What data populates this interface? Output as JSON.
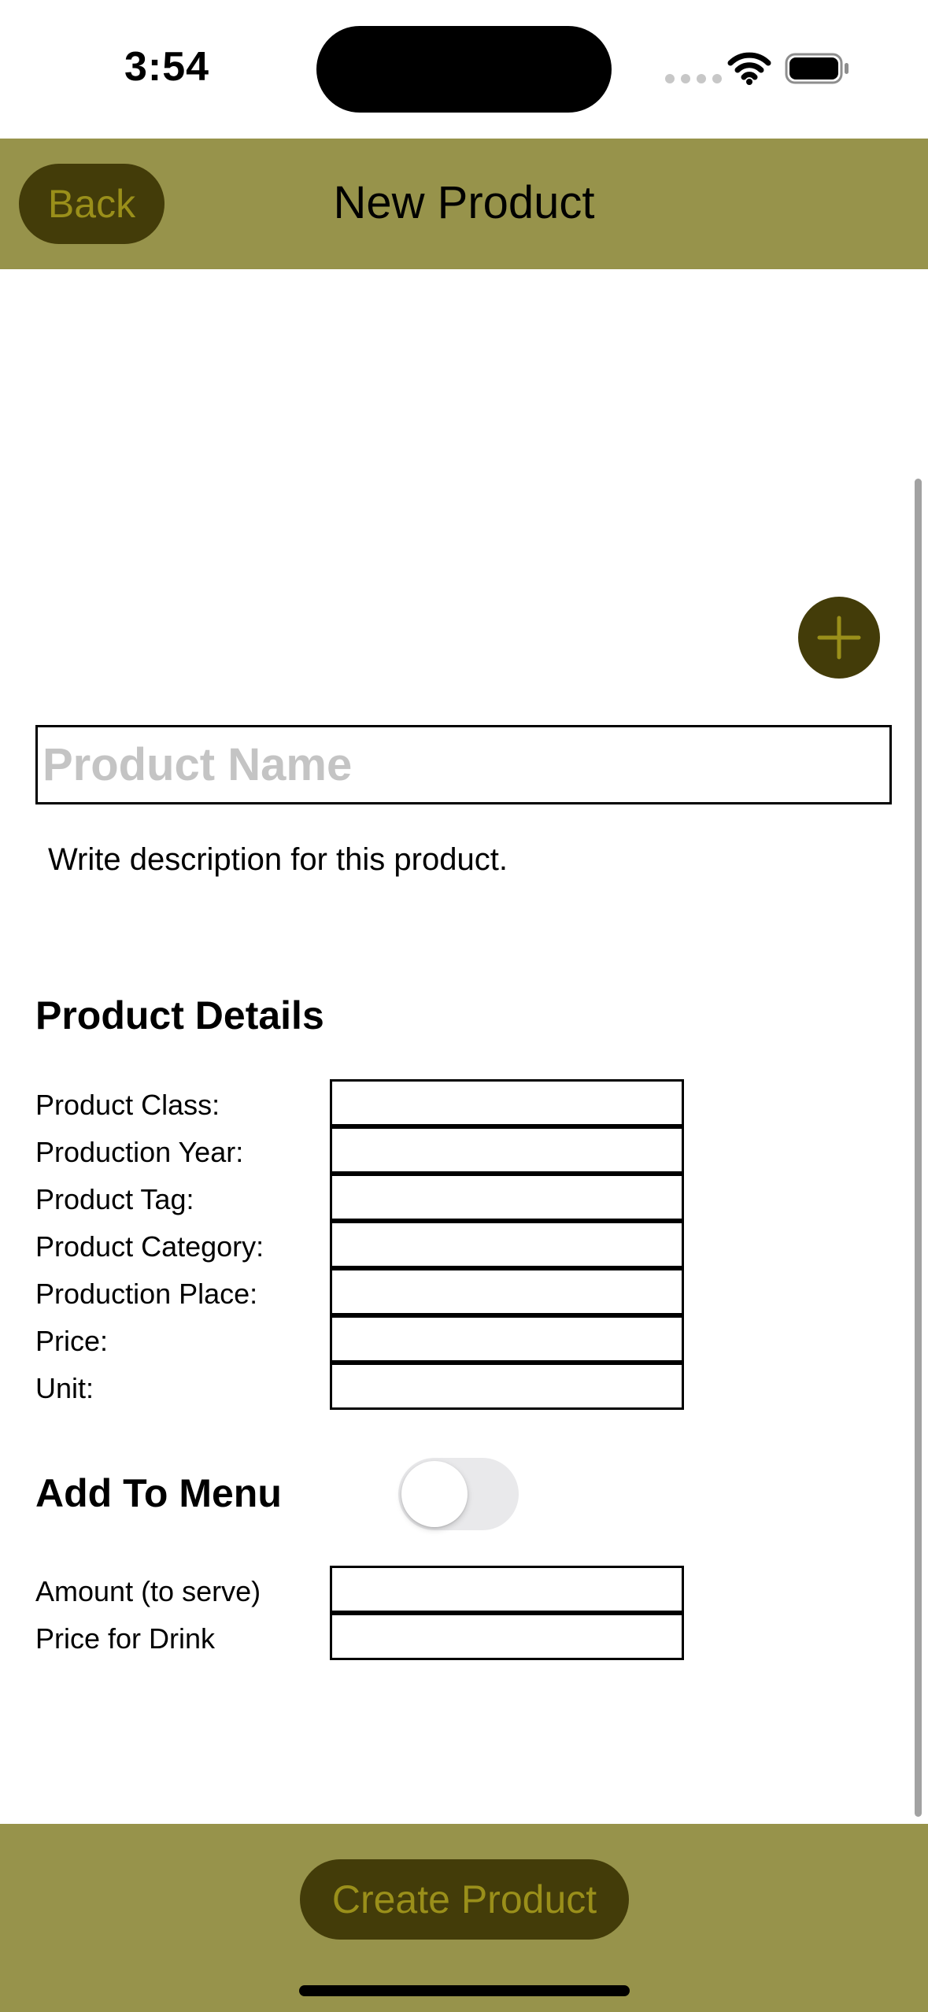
{
  "status_bar": {
    "time": "3:54"
  },
  "nav": {
    "back_label": "Back",
    "title": "New Product"
  },
  "form": {
    "name_placeholder": "Product Name",
    "name_value": "",
    "description": "Write description for this product.",
    "details_title": "Product Details",
    "details_fields": [
      {
        "label": "Product Class:",
        "value": ""
      },
      {
        "label": "Production Year:",
        "value": ""
      },
      {
        "label": "Product Tag:",
        "value": ""
      },
      {
        "label": "Product Category:",
        "value": ""
      },
      {
        "label": "Production Place:",
        "value": ""
      },
      {
        "label": "Price:",
        "value": ""
      },
      {
        "label": "Unit:",
        "value": ""
      }
    ],
    "menu_title": "Add To Menu",
    "menu_toggle_on": false,
    "menu_fields": [
      {
        "label": "Amount (to serve)",
        "value": ""
      },
      {
        "label": "Price for Drink",
        "value": ""
      }
    ]
  },
  "footer": {
    "create_label": "Create Product"
  },
  "colors": {
    "bar_bg": "#97934b",
    "button_bg": "#433c09",
    "button_text": "#9a8f1a",
    "toggle_off": "#e9e9eb"
  },
  "icons": {
    "wifi": "wifi-icon",
    "battery": "battery-icon",
    "add": "plus-icon"
  }
}
